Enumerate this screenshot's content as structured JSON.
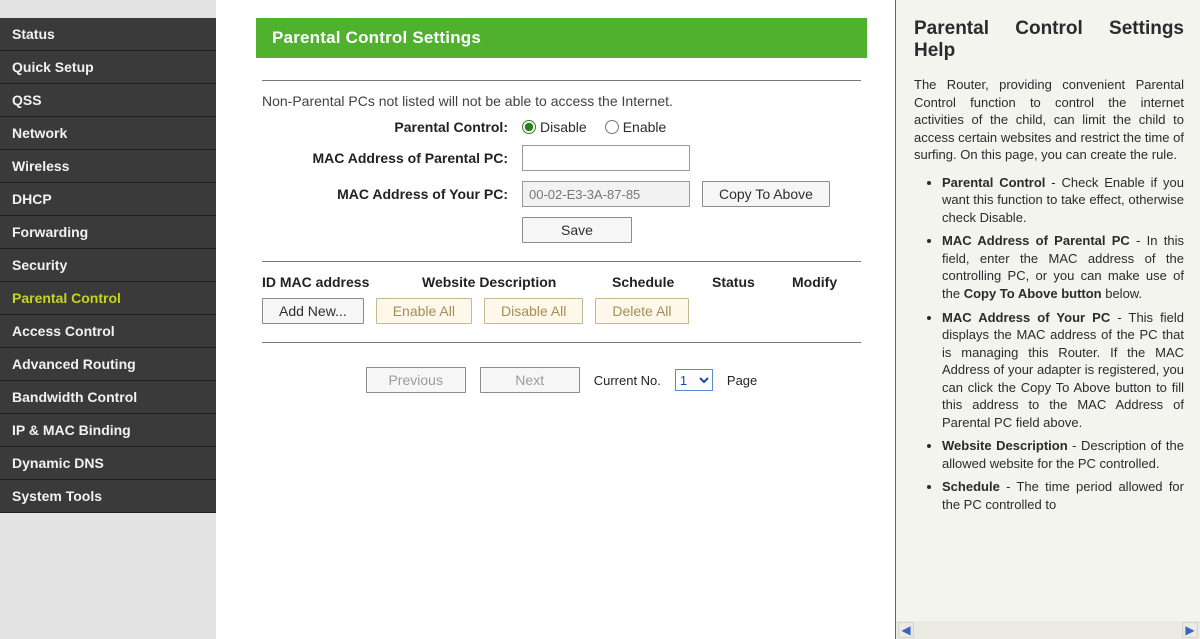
{
  "sidebar": {
    "items": [
      {
        "label": "Status"
      },
      {
        "label": "Quick Setup"
      },
      {
        "label": "QSS"
      },
      {
        "label": "Network"
      },
      {
        "label": "Wireless"
      },
      {
        "label": "DHCP"
      },
      {
        "label": "Forwarding"
      },
      {
        "label": "Security"
      },
      {
        "label": "Parental Control"
      },
      {
        "label": "Access Control"
      },
      {
        "label": "Advanced Routing"
      },
      {
        "label": "Bandwidth Control"
      },
      {
        "label": "IP & MAC Binding"
      },
      {
        "label": "Dynamic DNS"
      },
      {
        "label": "System Tools"
      }
    ],
    "active_index": 8
  },
  "main": {
    "title": "Parental Control Settings",
    "note": "Non-Parental PCs not listed will not be able to access the Internet.",
    "form": {
      "pc_label": "Parental Control:",
      "pc_disable": "Disable",
      "pc_enable": "Enable",
      "pc_selected": "disable",
      "mac_parental_label": "MAC Address of Parental PC:",
      "mac_parental_value": "",
      "mac_your_label": "MAC Address of Your PC:",
      "mac_your_value": "00-02-E3-3A-87-85",
      "copy_btn": "Copy To Above",
      "save_btn": "Save"
    },
    "table": {
      "headers": {
        "id_mac": "ID MAC address",
        "web_desc": "Website Description",
        "schedule": "Schedule",
        "status": "Status",
        "modify": "Modify"
      },
      "buttons": {
        "add_new": "Add New...",
        "enable_all": "Enable All",
        "disable_all": "Disable All",
        "delete_all": "Delete All"
      }
    },
    "pager": {
      "previous": "Previous",
      "next": "Next",
      "current_label": "Current No.",
      "page_label": "Page",
      "current_value": "1"
    }
  },
  "help": {
    "title": "Parental Control Settings Help",
    "intro": "The Router, providing convenient Parental Control function to control the internet activities of the child, can limit the child to access certain websites and restrict the time of surfing. On this page, you can create the rule.",
    "items": [
      {
        "bold": "Parental Control",
        "text": " - Check Enable if you want this function to take effect, otherwise check Disable."
      },
      {
        "bold": "MAC Address of Parental PC",
        "text": " - In this field, enter the MAC address of the controlling PC, or you can make use of the ",
        "bold2": "Copy To Above button",
        "text2": " below."
      },
      {
        "bold": "MAC Address of Your PC",
        "text": " - This field displays the MAC address of the PC that is managing this Router. If the MAC Address of your adapter is registered, you can click the Copy To Above button to fill this address to the MAC Address of Parental PC field above."
      },
      {
        "bold": "Website Description",
        "text": " - Description of the allowed website for the PC controlled."
      },
      {
        "bold": "Schedule",
        "text": " - The time period allowed for the PC controlled to"
      }
    ]
  }
}
